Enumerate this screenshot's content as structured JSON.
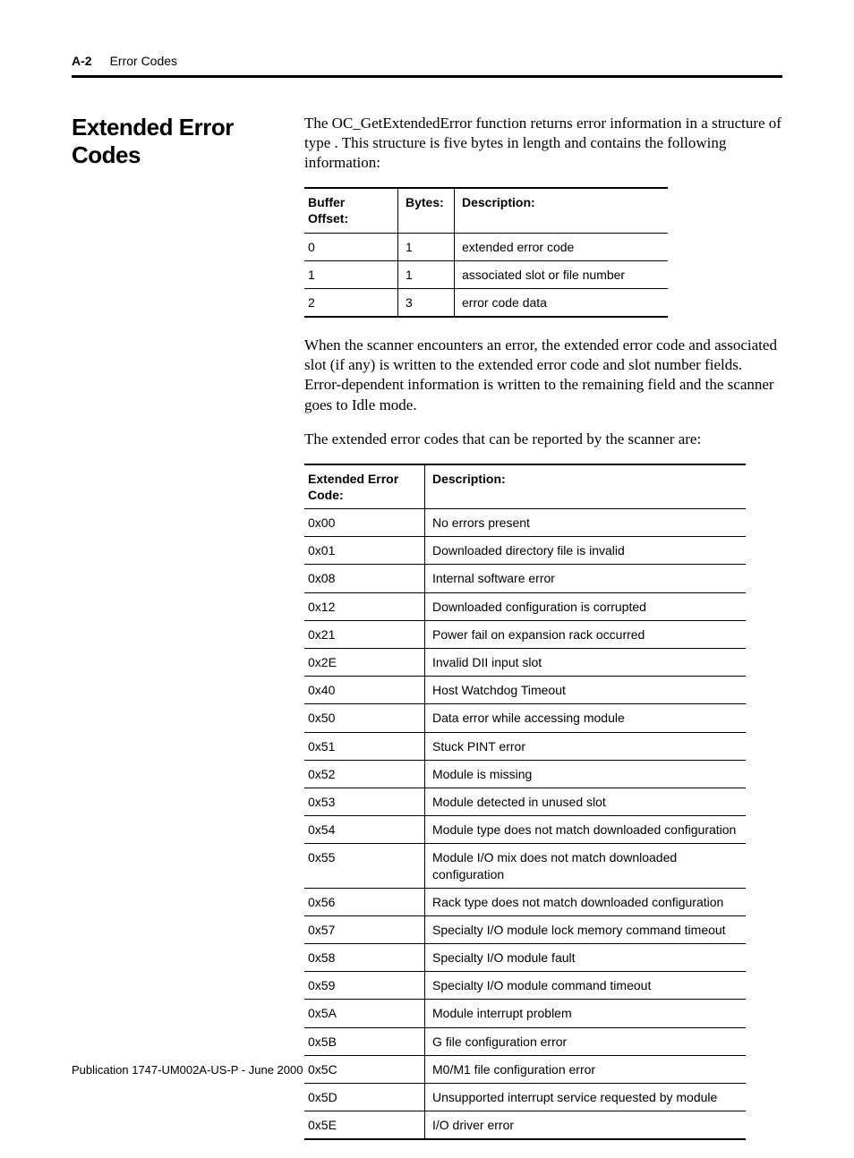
{
  "header": {
    "page_number": "A-2",
    "title": "Error Codes"
  },
  "section_heading": "Extended Error Codes",
  "paragraphs": {
    "intro": "The OC_GetExtendedError function returns error information in a structure of type               . This structure is five bytes in length and contains the following information:",
    "middle": "When the scanner encounters an error, the extended error code and associated slot (if any) is written to the extended error code and slot number fields. Error-dependent information is written to the remaining field and the scanner goes to Idle mode.",
    "lead_codes": "The extended error codes that can be reported by the scanner are:"
  },
  "buffer_table": {
    "headers": [
      "Buffer Offset:",
      "Bytes:",
      "Description:"
    ],
    "rows": [
      {
        "offset": "0",
        "bytes": "1",
        "desc": "extended error code"
      },
      {
        "offset": "1",
        "bytes": "1",
        "desc": "associated slot or file number"
      },
      {
        "offset": "2",
        "bytes": "3",
        "desc": "error code data"
      }
    ]
  },
  "codes_table": {
    "headers": [
      "Extended Error Code:",
      "Description:"
    ],
    "rows": [
      {
        "code": "0x00",
        "desc": "No errors present"
      },
      {
        "code": "0x01",
        "desc": "Downloaded directory file is invalid"
      },
      {
        "code": "0x08",
        "desc": "Internal software error"
      },
      {
        "code": "0x12",
        "desc": "Downloaded configuration is corrupted"
      },
      {
        "code": "0x21",
        "desc": "Power fail on expansion rack occurred"
      },
      {
        "code": "0x2E",
        "desc": "Invalid DII input slot"
      },
      {
        "code": "0x40",
        "desc": "Host Watchdog Timeout"
      },
      {
        "code": "0x50",
        "desc": "Data error while accessing module"
      },
      {
        "code": "0x51",
        "desc": "Stuck PINT error"
      },
      {
        "code": "0x52",
        "desc": "Module is missing"
      },
      {
        "code": "0x53",
        "desc": "Module detected in unused slot"
      },
      {
        "code": "0x54",
        "desc": "Module type does not match downloaded configuration"
      },
      {
        "code": "0x55",
        "desc": "Module I/O mix does not match downloaded configuration"
      },
      {
        "code": "0x56",
        "desc": "Rack type does not match downloaded configuration"
      },
      {
        "code": "0x57",
        "desc": "Specialty I/O module lock memory command timeout"
      },
      {
        "code": "0x58",
        "desc": "Specialty I/O module fault"
      },
      {
        "code": "0x59",
        "desc": "Specialty I/O module command timeout"
      },
      {
        "code": "0x5A",
        "desc": "Module interrupt problem"
      },
      {
        "code": "0x5B",
        "desc": "G file configuration error"
      },
      {
        "code": "0x5C",
        "desc": "M0/M1 file configuration error"
      },
      {
        "code": "0x5D",
        "desc": "Unsupported interrupt service requested by module"
      },
      {
        "code": "0x5E",
        "desc": "I/O driver error"
      }
    ]
  },
  "publication": "Publication 1747-UM002A-US-P - June 2000"
}
